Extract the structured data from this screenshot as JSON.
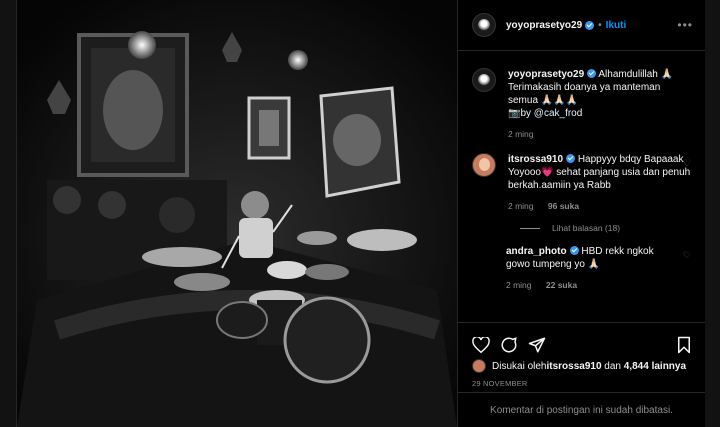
{
  "header": {
    "username": "yoyoprasetyo29",
    "separator": "•",
    "follow_label": "Ikuti",
    "more_label": "•••"
  },
  "caption": {
    "username": "yoyoprasetyo29",
    "text_line1": "Alhamdulillah 🙏🏻",
    "text_line2": "Terimakasih doanya ya manteman semua 🙏🏻🙏🏻🙏🏻",
    "credit_prefix": "📷by ",
    "credit_handle": "@cak_frod",
    "time": "2 ming"
  },
  "comments": [
    {
      "username": "itsrossa910",
      "text": "Happyyy bdqy Bapaaak Yoyooo💗 sehat panjang usia dan penuh berkah.aamiin ya Rabb",
      "time": "2 ming",
      "likes": "96 suka",
      "view_replies": "Lihat balasan (18)"
    },
    {
      "username": "andra_photo",
      "text": "HBD rekk ngkok gowo tumpeng yo 🙏🏻",
      "time": "2 ming",
      "likes": "22 suka"
    }
  ],
  "liked_by": {
    "prefix": "Disukai oleh ",
    "user": "itsrossa910",
    "and": " dan ",
    "others": "4,844 lainnya"
  },
  "date": "29 NOVEMBER",
  "footer": "Komentar di postingan ini sudah dibatasi.",
  "colors": {
    "accent": "#0095f6",
    "verified": "#3897f0",
    "muted": "#8e8e8e"
  }
}
